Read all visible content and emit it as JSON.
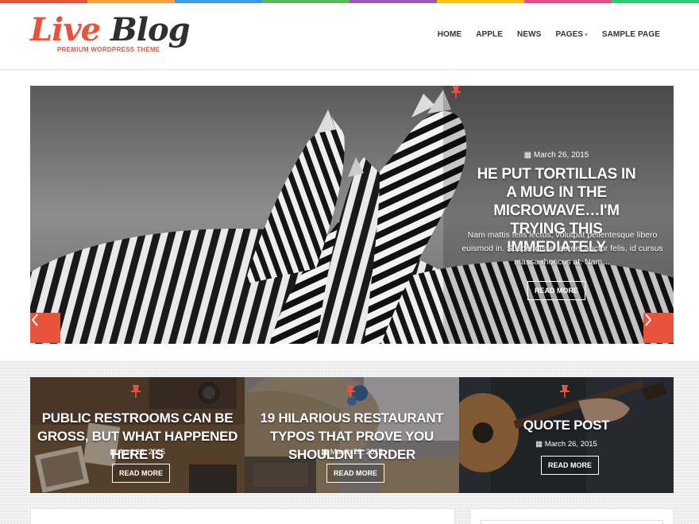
{
  "colors": {
    "accent": "#e8533c",
    "strip": [
      "#e8533c",
      "#f3a33b",
      "#3c9ae8",
      "#5cb85c",
      "#9b59b6",
      "#f1c40f",
      "#e84c8a",
      "#2ecc71"
    ]
  },
  "logo": {
    "word1": "Live",
    "word2": "Blog",
    "tagline": "PREMIUM WORDPRESS THEME"
  },
  "nav": {
    "items": [
      {
        "label": "HOME"
      },
      {
        "label": "APPLE"
      },
      {
        "label": "NEWS"
      },
      {
        "label": "PAGES",
        "has_dropdown": true
      },
      {
        "label": "SAMPLE PAGE"
      }
    ]
  },
  "slider": {
    "pin_icon": "pushpin-icon",
    "date": "March 26, 2015",
    "title": "HE PUT TORTILLAS IN A MUG IN THE MICROWAVE…I'M TRYING THIS IMMEDIATELY",
    "excerpt": "Nam mattis felis lectus, volutpat pellentesque libero euismod in. Suspendisse laoreet auctor felis, id cursus massa rhoncus at. Nam…",
    "button": "READ MORE",
    "prev_icon": "chevron-left-icon",
    "next_icon": "chevron-right-icon"
  },
  "cards": [
    {
      "title": "PUBLIC RESTROOMS CAN BE GROSS, BUT WHAT HAPPENED HERE IS",
      "date": "April 26, 2015",
      "button": "READ MORE"
    },
    {
      "title": "19 HILARIOUS RESTAURANT TYPOS THAT PROVE YOU SHOULDN'T ORDER",
      "date": "March 26, 2015",
      "button": "READ MORE"
    },
    {
      "title": "QUOTE POST",
      "date": "March 26, 2015",
      "button": "READ MORE"
    }
  ]
}
